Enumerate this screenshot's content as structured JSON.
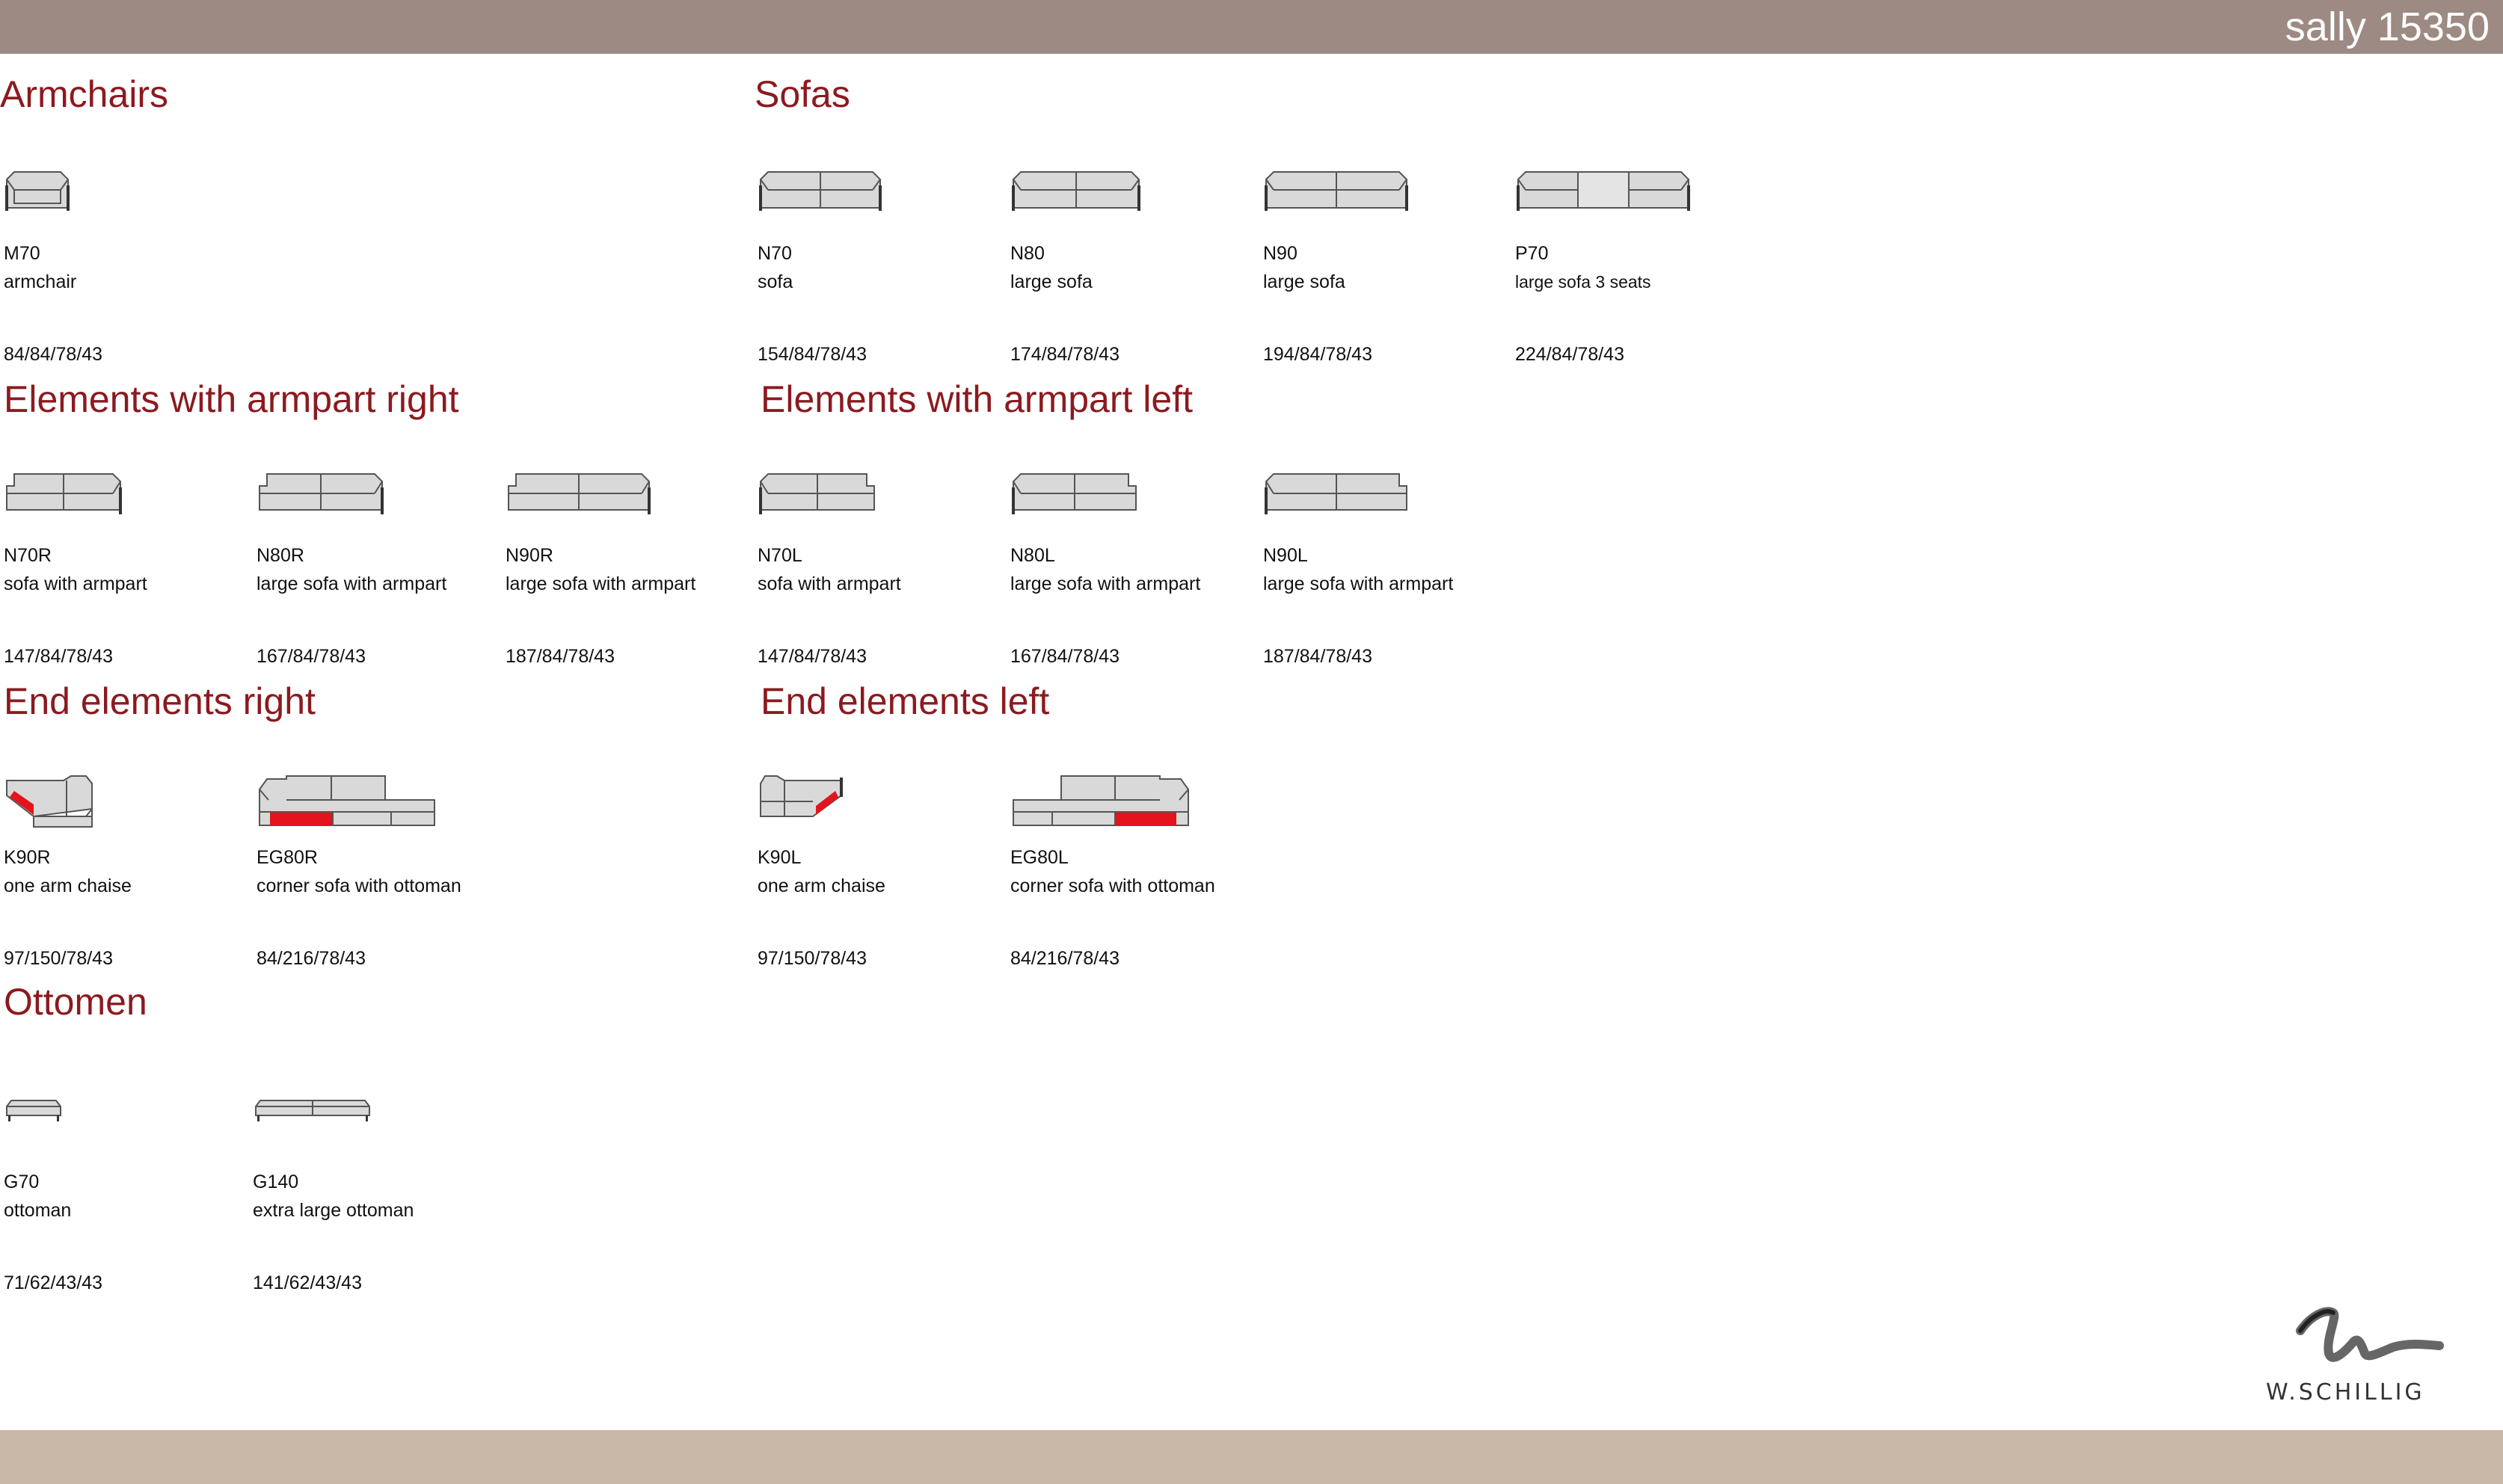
{
  "header": {
    "title": "sally 15350"
  },
  "sections": {
    "armchairs": "Armchairs",
    "sofas": "Sofas",
    "armpart_right": "Elements with armpart right",
    "armpart_left": "Elements with armpart left",
    "end_right": "End elements right",
    "end_left": "End elements left",
    "ottomen": "Ottomen"
  },
  "items": {
    "m70": {
      "code": "M70",
      "desc": "armchair",
      "dims": "84/84/78/43"
    },
    "n70": {
      "code": "N70",
      "desc": "sofa",
      "dims": "154/84/78/43"
    },
    "n80": {
      "code": "N80",
      "desc": "large sofa",
      "dims": "174/84/78/43"
    },
    "n90": {
      "code": "N90",
      "desc": "large sofa",
      "dims": "194/84/78/43"
    },
    "p70": {
      "code": "P70",
      "desc": "large sofa 3 seats",
      "dims": "224/84/78/43"
    },
    "n70r": {
      "code": "N70R",
      "desc": "sofa with armpart",
      "dims": "147/84/78/43"
    },
    "n80r": {
      "code": "N80R",
      "desc": "large sofa with armpart",
      "dims": "167/84/78/43"
    },
    "n90r": {
      "code": "N90R",
      "desc": "large sofa with armpart",
      "dims": "187/84/78/43"
    },
    "n70l": {
      "code": "N70L",
      "desc": "sofa with armpart",
      "dims": "147/84/78/43"
    },
    "n80l": {
      "code": "N80L",
      "desc": "large sofa with armpart",
      "dims": "167/84/78/43"
    },
    "n90l": {
      "code": "N90L",
      "desc": "large sofa with armpart",
      "dims": "187/84/78/43"
    },
    "k90r": {
      "code": "K90R",
      "desc": "one arm chaise",
      "dims": "97/150/78/43"
    },
    "eg80r": {
      "code": "EG80R",
      "desc": "corner sofa with ottoman",
      "dims": "84/216/78/43"
    },
    "k90l": {
      "code": "K90L",
      "desc": "one arm chaise",
      "dims": "97/150/78/43"
    },
    "eg80l": {
      "code": "EG80L",
      "desc": "corner sofa with ottoman",
      "dims": "84/216/78/43"
    },
    "g70": {
      "code": "G70",
      "desc": "ottoman",
      "dims": "71/62/43/43"
    },
    "g140": {
      "code": "G140",
      "desc": "extra large ottoman",
      "dims": "141/62/43/43"
    }
  },
  "logo": {
    "text": "W.SCHILLIG"
  },
  "colors": {
    "header": "#9c8a83",
    "footer": "#c8b7a6",
    "heading": "#8b1a1f",
    "highlight": "#e3141b",
    "fabric": "#d9d9d9"
  }
}
